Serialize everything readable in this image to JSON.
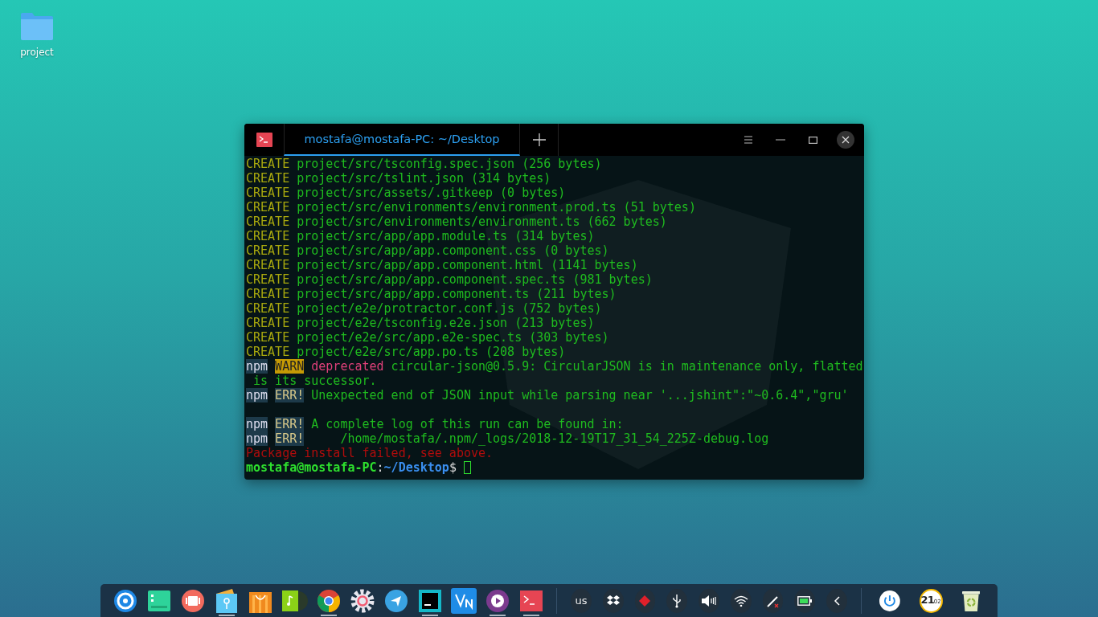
{
  "desktop": {
    "icons": [
      {
        "label": "project"
      }
    ]
  },
  "terminal": {
    "tabs": [
      {
        "title": "mostafa@mostafa-PC: ~/Desktop",
        "selected": true
      }
    ],
    "lines": [
      {
        "kind": "output",
        "segments": [
          {
            "t": "CREATE",
            "kind": "create"
          },
          {
            "t": " project/src/tsconfig.spec.json (256 bytes)",
            "kind": "text"
          }
        ]
      },
      {
        "kind": "output",
        "segments": [
          {
            "t": "CREATE",
            "kind": "create"
          },
          {
            "t": " project/src/tslint.json (314 bytes)",
            "kind": "text"
          }
        ]
      },
      {
        "kind": "output",
        "segments": [
          {
            "t": "CREATE",
            "kind": "create"
          },
          {
            "t": " project/src/assets/.gitkeep (0 bytes)",
            "kind": "text"
          }
        ]
      },
      {
        "kind": "output",
        "segments": [
          {
            "t": "CREATE",
            "kind": "create"
          },
          {
            "t": " project/src/environments/environment.prod.ts (51 bytes)",
            "kind": "text"
          }
        ]
      },
      {
        "kind": "output",
        "segments": [
          {
            "t": "CREATE",
            "kind": "create"
          },
          {
            "t": " project/src/environments/environment.ts (662 bytes)",
            "kind": "text"
          }
        ]
      },
      {
        "kind": "output",
        "segments": [
          {
            "t": "CREATE",
            "kind": "create"
          },
          {
            "t": " project/src/app/app.module.ts (314 bytes)",
            "kind": "text"
          }
        ]
      },
      {
        "kind": "output",
        "segments": [
          {
            "t": "CREATE",
            "kind": "create"
          },
          {
            "t": " project/src/app/app.component.css (0 bytes)",
            "kind": "text"
          }
        ]
      },
      {
        "kind": "output",
        "segments": [
          {
            "t": "CREATE",
            "kind": "create"
          },
          {
            "t": " project/src/app/app.component.html (1141 bytes)",
            "kind": "text"
          }
        ]
      },
      {
        "kind": "output",
        "segments": [
          {
            "t": "CREATE",
            "kind": "create"
          },
          {
            "t": " project/src/app/app.component.spec.ts (981 bytes)",
            "kind": "text"
          }
        ]
      },
      {
        "kind": "output",
        "segments": [
          {
            "t": "CREATE",
            "kind": "create"
          },
          {
            "t": " project/src/app/app.component.ts (211 bytes)",
            "kind": "text"
          }
        ]
      },
      {
        "kind": "output",
        "segments": [
          {
            "t": "CREATE",
            "kind": "create"
          },
          {
            "t": " project/e2e/protractor.conf.js (752 bytes)",
            "kind": "text"
          }
        ]
      },
      {
        "kind": "output",
        "segments": [
          {
            "t": "CREATE",
            "kind": "create"
          },
          {
            "t": " project/e2e/tsconfig.e2e.json (213 bytes)",
            "kind": "text"
          }
        ]
      },
      {
        "kind": "output",
        "segments": [
          {
            "t": "CREATE",
            "kind": "create"
          },
          {
            "t": " project/e2e/src/app.e2e-spec.ts (303 bytes)",
            "kind": "text"
          }
        ]
      },
      {
        "kind": "output",
        "segments": [
          {
            "t": "CREATE",
            "kind": "create"
          },
          {
            "t": " project/e2e/src/app.po.ts (208 bytes)",
            "kind": "text"
          }
        ]
      },
      {
        "kind": "output",
        "segments": [
          {
            "t": "npm",
            "kind": "npm"
          },
          {
            "t": "WARN",
            "kind": "warn"
          },
          {
            "t": " deprecated",
            "kind": "deprecated"
          },
          {
            "t": " circular-json@0.5.9: CircularJSON is in maintenance only, flatted",
            "kind": "text"
          }
        ]
      },
      {
        "kind": "output",
        "segments": [
          {
            "t": " is its successor.",
            "kind": "text"
          }
        ]
      },
      {
        "kind": "output",
        "segments": [
          {
            "t": "npm",
            "kind": "npm"
          },
          {
            "t": "ERR!",
            "kind": "err"
          },
          {
            "t": " Unexpected end of JSON input while parsing near '...jshint\":\"~0.6.4\",\"gru'",
            "kind": "text"
          }
        ]
      },
      {
        "kind": "blank"
      },
      {
        "kind": "output",
        "segments": [
          {
            "t": "npm",
            "kind": "npm"
          },
          {
            "t": "ERR!",
            "kind": "err"
          },
          {
            "t": " A complete log of this run can be found in:",
            "kind": "text"
          }
        ]
      },
      {
        "kind": "output",
        "segments": [
          {
            "t": "npm",
            "kind": "npm"
          },
          {
            "t": "ERR!",
            "kind": "err"
          },
          {
            "t": "     /home/mostafa/.npm/_logs/2018-12-19T17_31_54_225Z-debug.log",
            "kind": "text"
          }
        ]
      },
      {
        "kind": "output",
        "segments": [
          {
            "t": "Package install failed, see above.",
            "kind": "error"
          }
        ]
      },
      {
        "kind": "prompt",
        "segments": [
          {
            "t": "mostafa@mostafa-PC",
            "kind": "user"
          },
          {
            "t": ":",
            "kind": "plain"
          },
          {
            "t": "~/Desktop",
            "kind": "path"
          },
          {
            "t": "$",
            "kind": "plain"
          }
        ]
      }
    ]
  },
  "dock": {
    "apps": [
      {
        "kind": "launcher",
        "running": false
      },
      {
        "kind": "file-manager",
        "running": false
      },
      {
        "kind": "screen-recorder",
        "running": false
      },
      {
        "kind": "files",
        "running": true
      },
      {
        "kind": "store",
        "running": false
      },
      {
        "kind": "music",
        "running": false
      },
      {
        "kind": "chrome",
        "running": true
      },
      {
        "kind": "settings",
        "running": false
      },
      {
        "kind": "telegram",
        "running": false
      },
      {
        "kind": "webstorm",
        "running": true
      },
      {
        "kind": "vscode",
        "running": false
      },
      {
        "kind": "media-player",
        "running": true
      },
      {
        "kind": "terminal",
        "running": true
      }
    ],
    "tray": [
      {
        "kind": "keyboard",
        "label": "us"
      },
      {
        "kind": "dropbox"
      },
      {
        "kind": "diamond"
      },
      {
        "kind": "usb"
      },
      {
        "kind": "volume"
      },
      {
        "kind": "wifi"
      },
      {
        "kind": "pen"
      },
      {
        "kind": "battery"
      },
      {
        "kind": "expand"
      }
    ],
    "clock": {
      "hours": "21",
      "minutes": "02"
    }
  }
}
